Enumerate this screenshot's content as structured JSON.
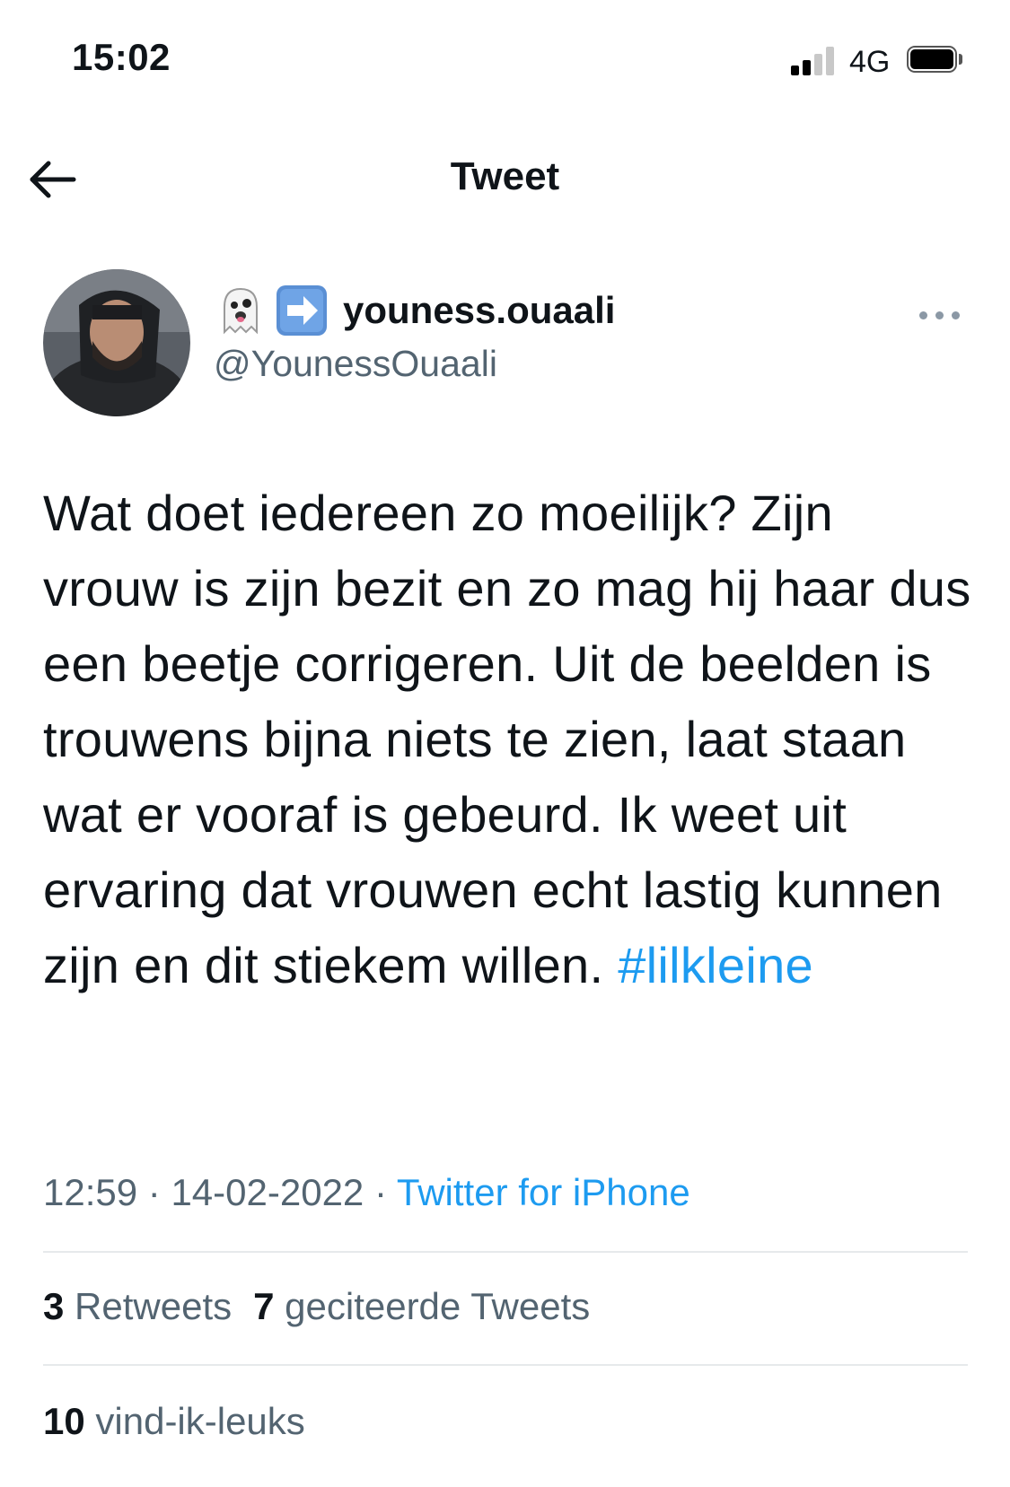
{
  "status_bar": {
    "time": "15:02",
    "network": "4G",
    "signal_bars_active": 2,
    "signal_bars_total": 4
  },
  "nav": {
    "title": "Tweet",
    "back_icon": "arrow-left-icon"
  },
  "author": {
    "emoji_1": "ghost-emoji-icon",
    "emoji_2": "right-arrow-emoji-icon",
    "display_name": "youness.ouaali",
    "handle": "@YounessOuaali",
    "more_icon": "more-dots-icon"
  },
  "tweet": {
    "text": "Wat doet iedereen zo moeilijk? Zijn vrouw is zijn bezit en zo mag hij haar dus een beetje corrigeren. Uit de beelden is trouwens bijna niets te zien, laat staan wat er vooraf is gebeurd. Ik weet uit ervaring dat vrouwen echt lastig kunnen zijn en dit stiekem willen.",
    "hashtag": "#lilkleine"
  },
  "meta": {
    "time": "12:59",
    "separator": "·",
    "date": "14-02-2022",
    "source": "Twitter for iPhone"
  },
  "stats": {
    "retweets_count": "3",
    "retweets_label": "Retweets",
    "quotes_count": "7",
    "quotes_label": "geciteerde Tweets",
    "likes_count": "10",
    "likes_label": "vind-ik-leuks"
  },
  "colors": {
    "link": "#1d9bf0",
    "secondary_text": "#536471",
    "primary_text": "#0f1419",
    "divider": "#e6e9eb"
  }
}
